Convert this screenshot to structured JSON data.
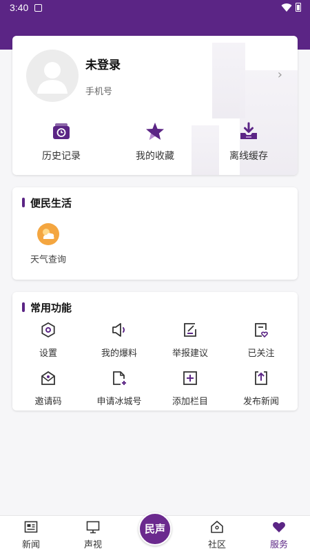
{
  "status_bar": {
    "time": "3:40"
  },
  "profile": {
    "title": "未登录",
    "phone_label": "手机号",
    "quick_actions": [
      {
        "label": "历史记录",
        "icon": "history-icon"
      },
      {
        "label": "我的收藏",
        "icon": "star-icon"
      },
      {
        "label": "离线缓存",
        "icon": "download-icon"
      }
    ]
  },
  "life": {
    "title": "便民生活",
    "items": [
      {
        "label": "天气查询",
        "icon": "weather-icon"
      }
    ]
  },
  "functions": {
    "title": "常用功能",
    "items": [
      {
        "label": "设置",
        "icon": "settings-icon"
      },
      {
        "label": "我的爆料",
        "icon": "megaphone-icon"
      },
      {
        "label": "举报建议",
        "icon": "report-icon"
      },
      {
        "label": "已关注",
        "icon": "followed-icon"
      },
      {
        "label": "邀请码",
        "icon": "invite-icon"
      },
      {
        "label": "申请冰城号",
        "icon": "apply-document-icon"
      },
      {
        "label": "添加栏目",
        "icon": "add-column-icon"
      },
      {
        "label": "发布新闻",
        "icon": "publish-icon"
      }
    ]
  },
  "bottom_nav": {
    "items": [
      {
        "label": "新闻",
        "icon": "news-icon"
      },
      {
        "label": "声视",
        "icon": "monitor-icon"
      },
      {
        "label": "社区",
        "icon": "community-house-icon"
      },
      {
        "label": "服务",
        "icon": "heart-icon",
        "active": true
      }
    ],
    "center_label": "民声"
  },
  "colors": {
    "brand": "#5b2585",
    "weather": "#f4a640"
  }
}
